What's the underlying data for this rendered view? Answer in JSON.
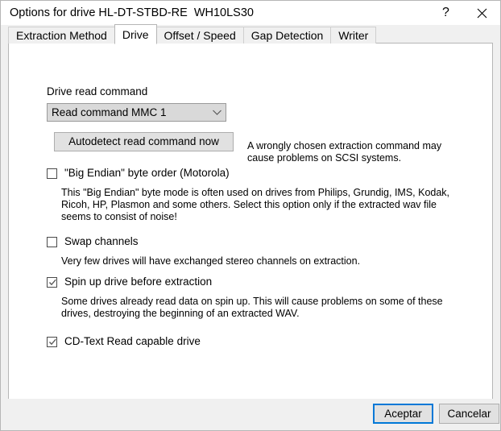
{
  "window": {
    "title": "Options for drive HL-DT-STBD-RE  WH10LS30",
    "help_glyph": "?",
    "help_name": "help-button",
    "close_name": "close-button"
  },
  "tabs": [
    {
      "label": "Extraction Method",
      "active": false
    },
    {
      "label": "Drive",
      "active": true
    },
    {
      "label": "Offset / Speed",
      "active": false
    },
    {
      "label": "Gap Detection",
      "active": false
    },
    {
      "label": "Writer",
      "active": false
    }
  ],
  "drive": {
    "read_command_label": "Drive read command",
    "read_command_value": "Read command MMC 1",
    "read_command_hint": "A wrongly chosen extraction command may cause problems on SCSI systems.",
    "autodetect_button": "Autodetect read command now"
  },
  "options": [
    {
      "label": "\"Big Endian\" byte order (Motorola)",
      "checked": false,
      "description": "This \"Big Endian\" byte mode is often used on drives from Philips, Grundig, IMS, Kodak, Ricoh, HP, Plasmon and some others. Select this option only if the extracted wav file seems to consist of noise!"
    },
    {
      "label": "Swap channels",
      "checked": false,
      "description": "Very few drives will have exchanged stereo channels on extraction."
    },
    {
      "label": "Spin up drive before extraction",
      "checked": true,
      "description": "Some drives already read data on spin up. This will cause problems on some of these drives, destroying the beginning of an extracted WAV."
    },
    {
      "label": "CD-Text Read capable drive",
      "checked": true,
      "description": ""
    }
  ],
  "footer": {
    "ok_label": "Aceptar",
    "cancel_label": "Cancelar"
  },
  "colors": {
    "accent": "#0078d7",
    "window_bg": "#f0f0f0",
    "panel_bg": "#ffffff",
    "control_bg": "#e1e1e1",
    "combo_bg": "#d9d9d9"
  }
}
